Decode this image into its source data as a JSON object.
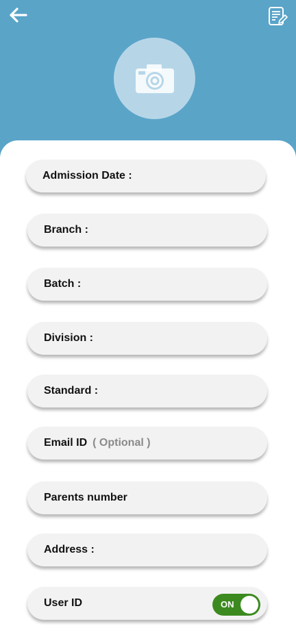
{
  "header": {
    "back_icon": "arrow-left-icon",
    "edit_icon": "edit-document-icon",
    "photo_icon": "camera-icon",
    "background_color": "#5aa4c8"
  },
  "form": {
    "fields": [
      {
        "label": "Admission Date :"
      },
      {
        "label": "Branch :"
      },
      {
        "label": "Batch :"
      },
      {
        "label": "Division :"
      },
      {
        "label": "Standard :"
      },
      {
        "label": "Email ID",
        "hint": "( Optional )"
      },
      {
        "label": "Parents number"
      },
      {
        "label": "Address :"
      },
      {
        "label": "User ID",
        "toggle": {
          "state": "ON",
          "color": "#3c8a1f"
        }
      }
    ]
  }
}
